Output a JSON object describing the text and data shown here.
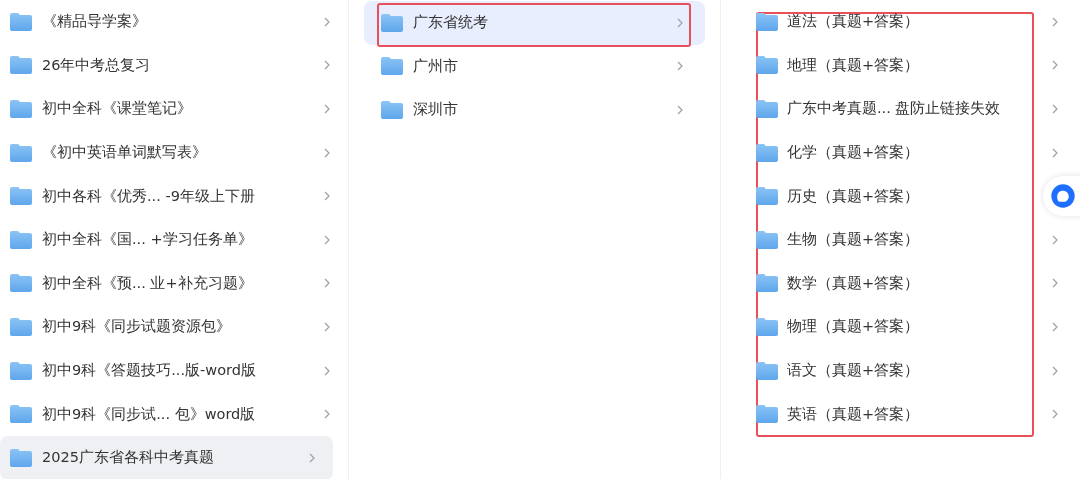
{
  "columns": [
    {
      "outlined": false,
      "items": [
        {
          "label": "《精品导学案》",
          "selected": false
        },
        {
          "label": "26年中考总复习",
          "selected": false
        },
        {
          "label": "初中全科《课堂笔记》",
          "selected": false
        },
        {
          "label": "《初中英语单词默写表》",
          "selected": false
        },
        {
          "label": "初中各科《优秀...  -9年级上下册",
          "selected": false
        },
        {
          "label": "初中全科《国...  +学习任务单》",
          "selected": false
        },
        {
          "label": "初中全科《预...  业+补充习题》",
          "selected": false
        },
        {
          "label": "初中9科《同步试题资源包》",
          "selected": false
        },
        {
          "label": "初中9科《答题技巧...版-word版",
          "selected": false
        },
        {
          "label": "初中9科《同步试... 包》word版",
          "selected": false
        },
        {
          "label": "2025广东省各科中考真题",
          "selected": true
        }
      ]
    },
    {
      "outlined": false,
      "items": [
        {
          "label": "广东省统考",
          "selected": true,
          "outlined": true
        },
        {
          "label": "广州市",
          "selected": false,
          "outlined": false
        },
        {
          "label": "深圳市",
          "selected": false,
          "outlined": false
        }
      ]
    },
    {
      "outlined": true,
      "items": [
        {
          "label": "道法（真题+答案）",
          "selected": false
        },
        {
          "label": "地理（真题+答案）",
          "selected": false
        },
        {
          "label": "广东中考真题... 盘防止链接失效",
          "selected": false
        },
        {
          "label": "化学（真题+答案）",
          "selected": false
        },
        {
          "label": "历史（真题+答案）",
          "selected": false,
          "chevron": false
        },
        {
          "label": "生物（真题+答案）",
          "selected": false
        },
        {
          "label": "数学（真题+答案）",
          "selected": false
        },
        {
          "label": "物理（真题+答案）",
          "selected": false
        },
        {
          "label": "语文（真题+答案）",
          "selected": false
        },
        {
          "label": "英语（真题+答案）",
          "selected": false
        }
      ]
    }
  ]
}
